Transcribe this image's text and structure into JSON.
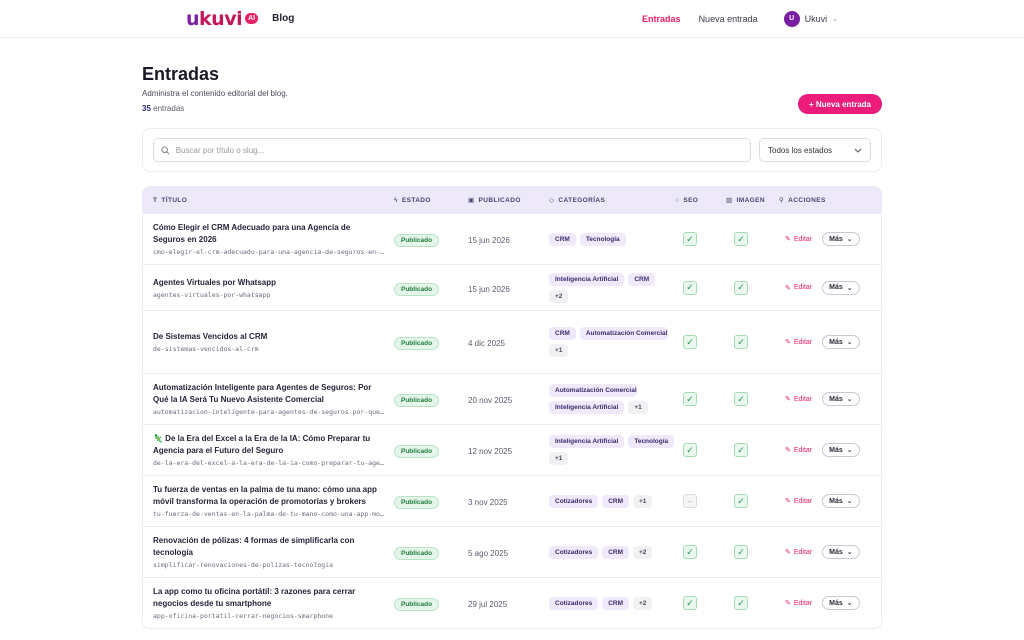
{
  "nav": {
    "brand_word": "ukuvi",
    "brand_badge": "AI",
    "section": "Blog",
    "links": [
      {
        "label": "Entradas",
        "active": true
      },
      {
        "label": "Nueva entrada",
        "active": false
      }
    ],
    "user": {
      "initial": "U",
      "name": "Ukuvi"
    }
  },
  "page": {
    "title": "Entradas",
    "subtitle": "Administra el contenido editorial del blog.",
    "count_number": "35",
    "count_label": "entradas",
    "new_button": "+ Nueva entrada"
  },
  "filters": {
    "search_placeholder": "Buscar por título o slug...",
    "status_selected": "Todos los estados"
  },
  "table": {
    "headers": {
      "title": "TÍTULO",
      "estado": "ESTADO",
      "publicado": "PUBLICADO",
      "categorias": "CATEGORÍAS",
      "seo": "SEO",
      "imagen": "IMAGEN",
      "acciones": "ACCIONES"
    },
    "edit_label": "Editar",
    "more_label": "Más",
    "rows": [
      {
        "title": "Cómo Elegir el CRM Adecuado para una Agencia de Seguros en 2026",
        "slug": "cmo-elegir-el-crm-adecuado-para-una-agencia-de-seguros-en-2026",
        "status": "Publicado",
        "date": "15 jun 2026",
        "categories": [
          "CRM",
          "Tecnología"
        ],
        "more": "",
        "seo": true,
        "image": true
      },
      {
        "title": "Agentes Virtuales por Whatsapp",
        "slug": "agentes-virtuales-por-whatsapp",
        "status": "Publicado",
        "date": "15 jun 2026",
        "categories": [
          "Inteligencia Artificial",
          "CRM"
        ],
        "more": "+2",
        "seo": true,
        "image": true
      },
      {
        "title": "De Sistemas Vencidos al CRM",
        "slug": "de-sistemas-vencidos-al-crm",
        "status": "Publicado",
        "date": "4 dic 2025",
        "categories": [
          "CRM",
          "Automatización Comercial"
        ],
        "more": "+1",
        "seo": true,
        "image": true
      },
      {
        "title": "Automatización Inteligente para Agentes de Seguros: Por Qué la IA Será Tu Nuevo Asistente Comercial",
        "slug": "automatizacion-inteligente-para-agentes-de-seguros-por-que-la-ia",
        "status": "Publicado",
        "date": "20 nov 2025",
        "categories": [
          "Automatización Comercial",
          "Inteligencia Artificial"
        ],
        "more": "+1",
        "seo": true,
        "image": true
      },
      {
        "title": "🦎 De la Era del Excel a la Era de la IA: Cómo Preparar tu Agencia para el Futuro del Seguro",
        "slug": "de-la-era-del-excel-a-la-era-de-la-ia-como-preparar-tu-agencia",
        "status": "Publicado",
        "date": "12 nov 2025",
        "categories": [
          "Inteligencia Artificial",
          "Tecnología"
        ],
        "more": "+1",
        "seo": true,
        "image": true
      },
      {
        "title": "Tu fuerza de ventas en la palma de tu mano: cómo una app móvil transforma la operación de promotorías y brokers",
        "slug": "tu-fuerza-de-ventas-en-la-palma-de-tu-mano-como-una-app-movil",
        "status": "Publicado",
        "date": "3 nov 2025",
        "categories": [
          "Cotizadores",
          "CRM"
        ],
        "more": "+1",
        "seo": false,
        "image": true
      },
      {
        "title": "Renovación de pólizas: 4 formas de simplificarla con tecnología",
        "slug": "simplificar-renovaciones-de-polizas-tecnologia",
        "status": "Publicado",
        "date": "5 ago 2025",
        "categories": [
          "Cotizadores",
          "CRM"
        ],
        "more": "+2",
        "seo": true,
        "image": true
      },
      {
        "title": "La app como tu oficina portátil: 3 razones para cerrar negocios desde tu smartphone",
        "slug": "app-oficina-portatil-cerrar-negocios-smarphone",
        "status": "Publicado",
        "date": "29 jul 2025",
        "categories": [
          "Cotizadores",
          "CRM"
        ],
        "more": "+2",
        "seo": true,
        "image": true
      }
    ]
  },
  "colors": {
    "accent": "#e91e63",
    "brand_purple": "#7a1fa2",
    "header_bg": "#ede9fb"
  }
}
